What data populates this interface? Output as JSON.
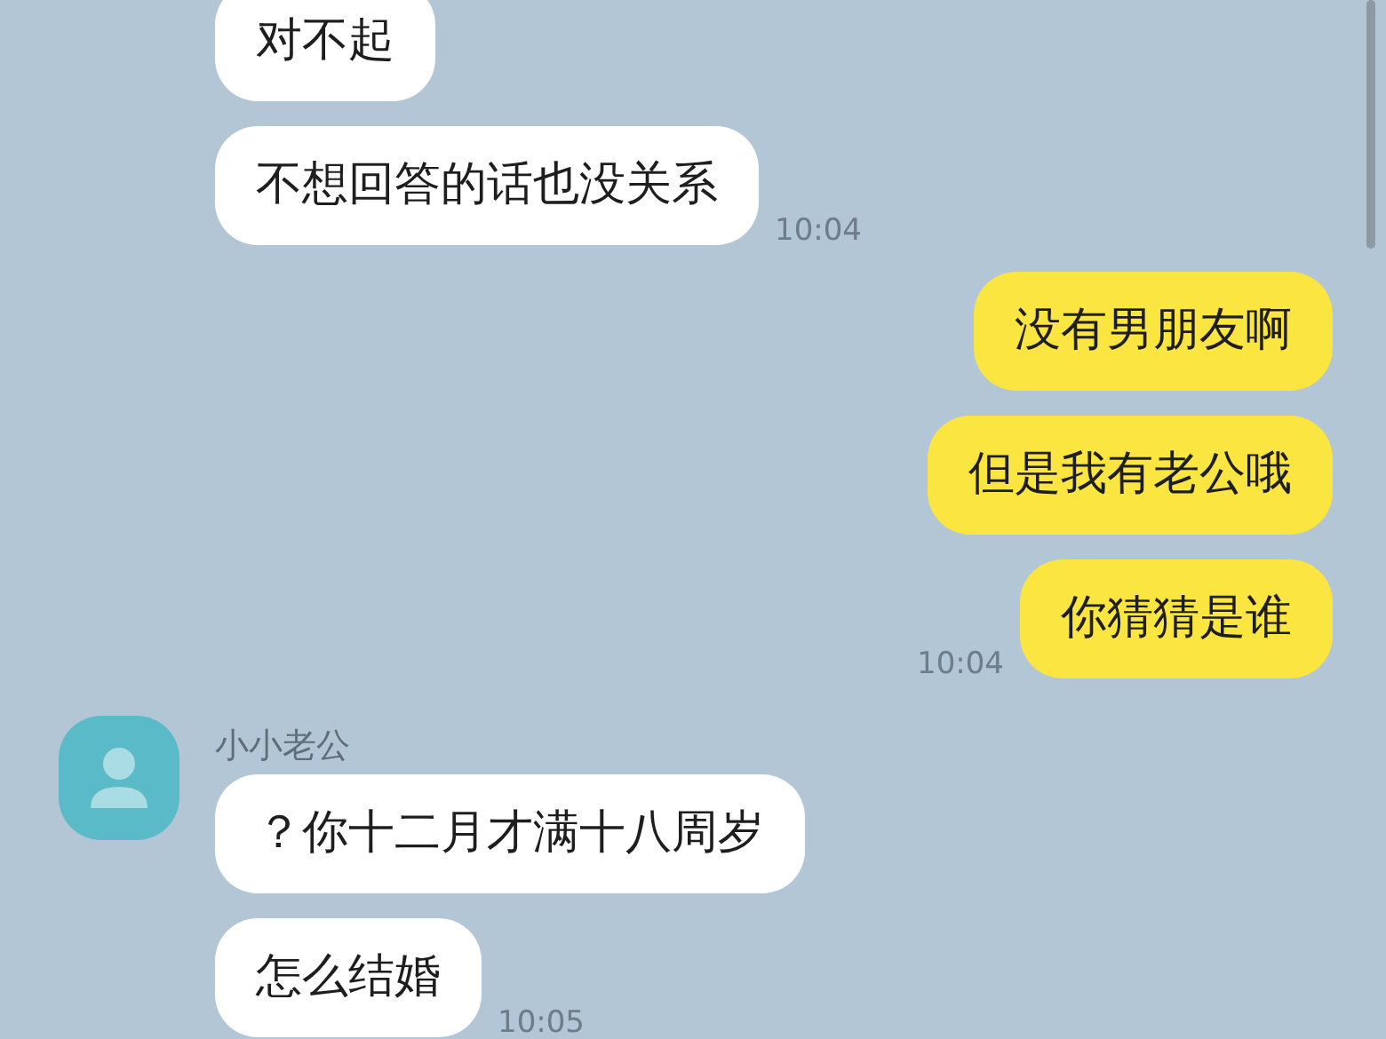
{
  "groups": [
    {
      "kind": "incoming",
      "messages": [
        "对不起",
        "不想回答的话也没关系"
      ],
      "time": "10:04"
    },
    {
      "kind": "outgoing",
      "messages": [
        "没有男朋友啊",
        "但是我有老公哦",
        "你猜猜是谁"
      ],
      "time": "10:04"
    },
    {
      "kind": "incoming",
      "sender": "小小老公",
      "messages": [
        "？你十二月才满十八周岁",
        "怎么结婚"
      ],
      "time": "10:05"
    }
  ]
}
